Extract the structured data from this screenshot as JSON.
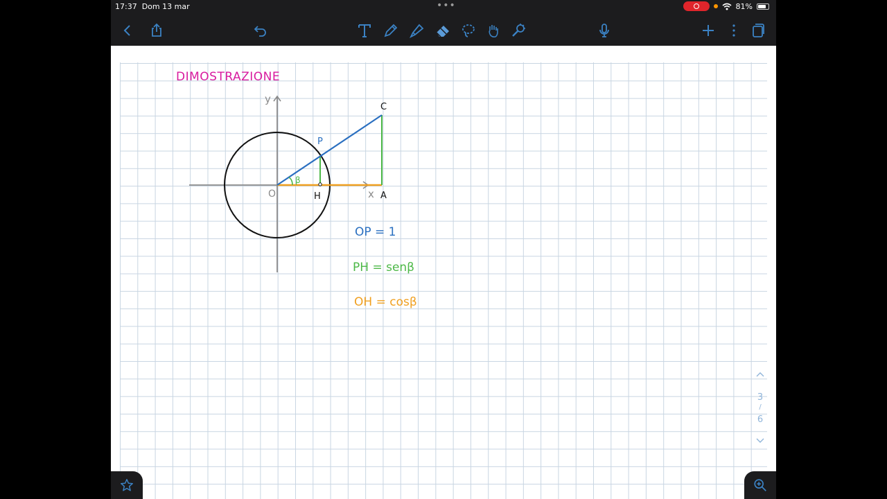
{
  "status": {
    "time": "17:37",
    "date": "Dom 13 mar",
    "battery": "81%",
    "battery_level": 0.81
  },
  "toolbar": {
    "icons": [
      "chevron-left-icon",
      "share-icon",
      "undo-icon",
      "text-icon",
      "pen-icon",
      "highlighter-icon",
      "eraser-icon",
      "lasso-icon",
      "hand-icon",
      "laser-icon",
      "microphone-icon",
      "plus-icon",
      "more-icon",
      "pages-icon"
    ]
  },
  "note": {
    "title": "DIMOSTRAZIONE",
    "axis_y": "y",
    "axis_x": "x",
    "label_o": "O",
    "label_p": "P",
    "label_h": "H",
    "label_c": "C",
    "label_a": "A",
    "label_beta": "β",
    "eq1": "OP = 1",
    "eq2": "PH = senβ",
    "eq3": "OH = cosβ"
  },
  "colors": {
    "title": "#d81b9f",
    "blue": "#2a6fc0",
    "green": "#4cb847",
    "orange": "#f0a020",
    "axis": "#8a8a8a",
    "ink": "#111111",
    "ui_blue": "#3b82c4"
  },
  "pager": {
    "current": "3",
    "separator": "/",
    "total": "6"
  }
}
